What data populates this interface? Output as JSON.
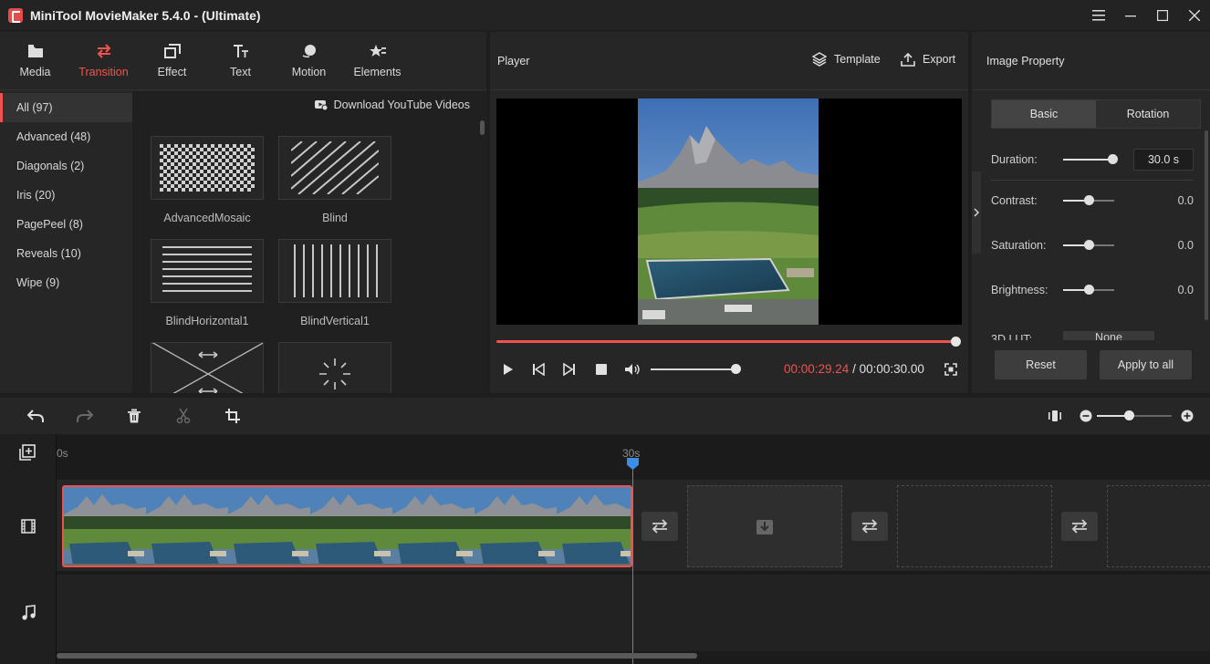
{
  "window": {
    "title": "MiniTool MovieMaker 5.4.0 - (Ultimate)"
  },
  "library": {
    "tabs": [
      {
        "label": "Media",
        "icon": "folder-icon"
      },
      {
        "label": "Transition",
        "icon": "transition-icon",
        "active": true
      },
      {
        "label": "Effect",
        "icon": "effect-icon"
      },
      {
        "label": "Text",
        "icon": "text-icon"
      },
      {
        "label": "Motion",
        "icon": "motion-icon"
      },
      {
        "label": "Elements",
        "icon": "elements-icon"
      }
    ],
    "categories": [
      {
        "label": "All (97)",
        "active": true
      },
      {
        "label": "Advanced (48)"
      },
      {
        "label": "Diagonals (2)"
      },
      {
        "label": "Iris (20)"
      },
      {
        "label": "PagePeel (8)"
      },
      {
        "label": "Reveals (10)"
      },
      {
        "label": "Wipe (9)"
      }
    ],
    "download_label": "Download YouTube Videos",
    "items": [
      {
        "label": "AdvancedMosaic",
        "icon": "checkerboard-icon"
      },
      {
        "label": "Blind",
        "icon": "diagonal-lines-icon"
      },
      {
        "label": "BlindHorizontal1",
        "icon": "horizontal-lines-icon"
      },
      {
        "label": "BlindVertical1",
        "icon": "vertical-lines-icon"
      },
      {
        "label": "",
        "icon": "cross-arrows-icon"
      },
      {
        "label": "",
        "icon": "burst-icon"
      }
    ]
  },
  "player": {
    "title": "Player",
    "template_label": "Template",
    "export_label": "Export",
    "progress": 1.0,
    "volume": 0.95,
    "current_time": "00:00:29.24",
    "time_separator": " / ",
    "total_time": "00:00:30.00"
  },
  "properties": {
    "title": "Image Property",
    "tabs": [
      {
        "label": "Basic",
        "active": true
      },
      {
        "label": "Rotation"
      }
    ],
    "duration_label": "Duration:",
    "duration_value": "30.0 s",
    "duration_level": 0.98,
    "sliders": [
      {
        "label": "Contrast:",
        "value": "0.0",
        "level": 0.5
      },
      {
        "label": "Saturation:",
        "value": "0.0",
        "level": 0.5
      },
      {
        "label": "Brightness:",
        "value": "0.0",
        "level": 0.5
      }
    ],
    "lut_label": "3D LUT:",
    "lut_value": "None",
    "reset_label": "Reset",
    "apply_label": "Apply to all"
  },
  "timeline": {
    "ruler_start": "0s",
    "ruler_mark": "30s",
    "zoom_level": 0.44
  },
  "colors": {
    "accent": "#f0534e",
    "playhead": "#3a8ee6"
  }
}
